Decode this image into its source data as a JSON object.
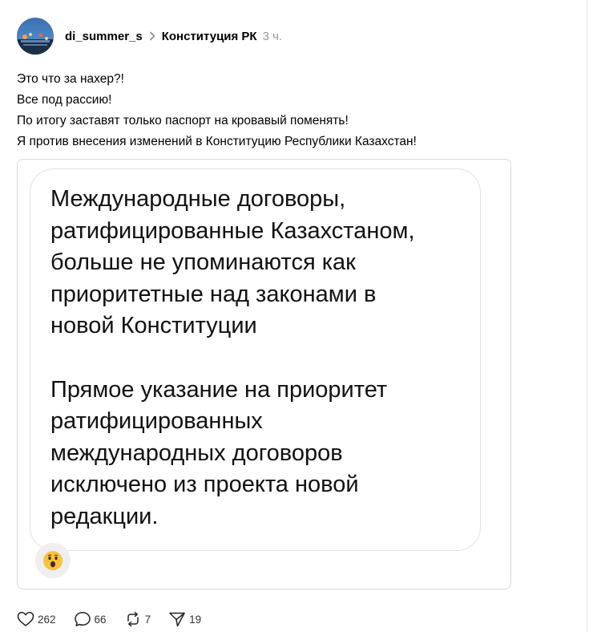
{
  "post": {
    "author": "di_summer_s",
    "community": "Конституция РК",
    "time": "3 ч.",
    "lines": [
      "Это что за нахер?!",
      "Все под рассию!",
      "По итогу заставят только паспорт на кровавый поменять!",
      "Я против внесения изменений в Конституцию Республики Казахстан!"
    ]
  },
  "media": {
    "paragraph1": [
      "Международные договоры,",
      "ратифицированные Казахстаном,",
      "больше не упоминаются как",
      "приоритетные над законами в",
      "новой Конституции"
    ],
    "paragraph2": [
      "Прямое указание на приоритет",
      "ратифицированных",
      "международных договоров",
      "исключено из проекта новой",
      "редакции."
    ],
    "reaction_emoji": "😮"
  },
  "actions": {
    "likes": "262",
    "comments": "66",
    "reposts": "7",
    "shares": "19"
  },
  "icons": {
    "avatar": "avatar-image",
    "chevron": "chevron-right-icon",
    "like": "heart-icon",
    "comment": "comment-bubble-icon",
    "repost": "repost-icon",
    "share": "send-icon"
  }
}
